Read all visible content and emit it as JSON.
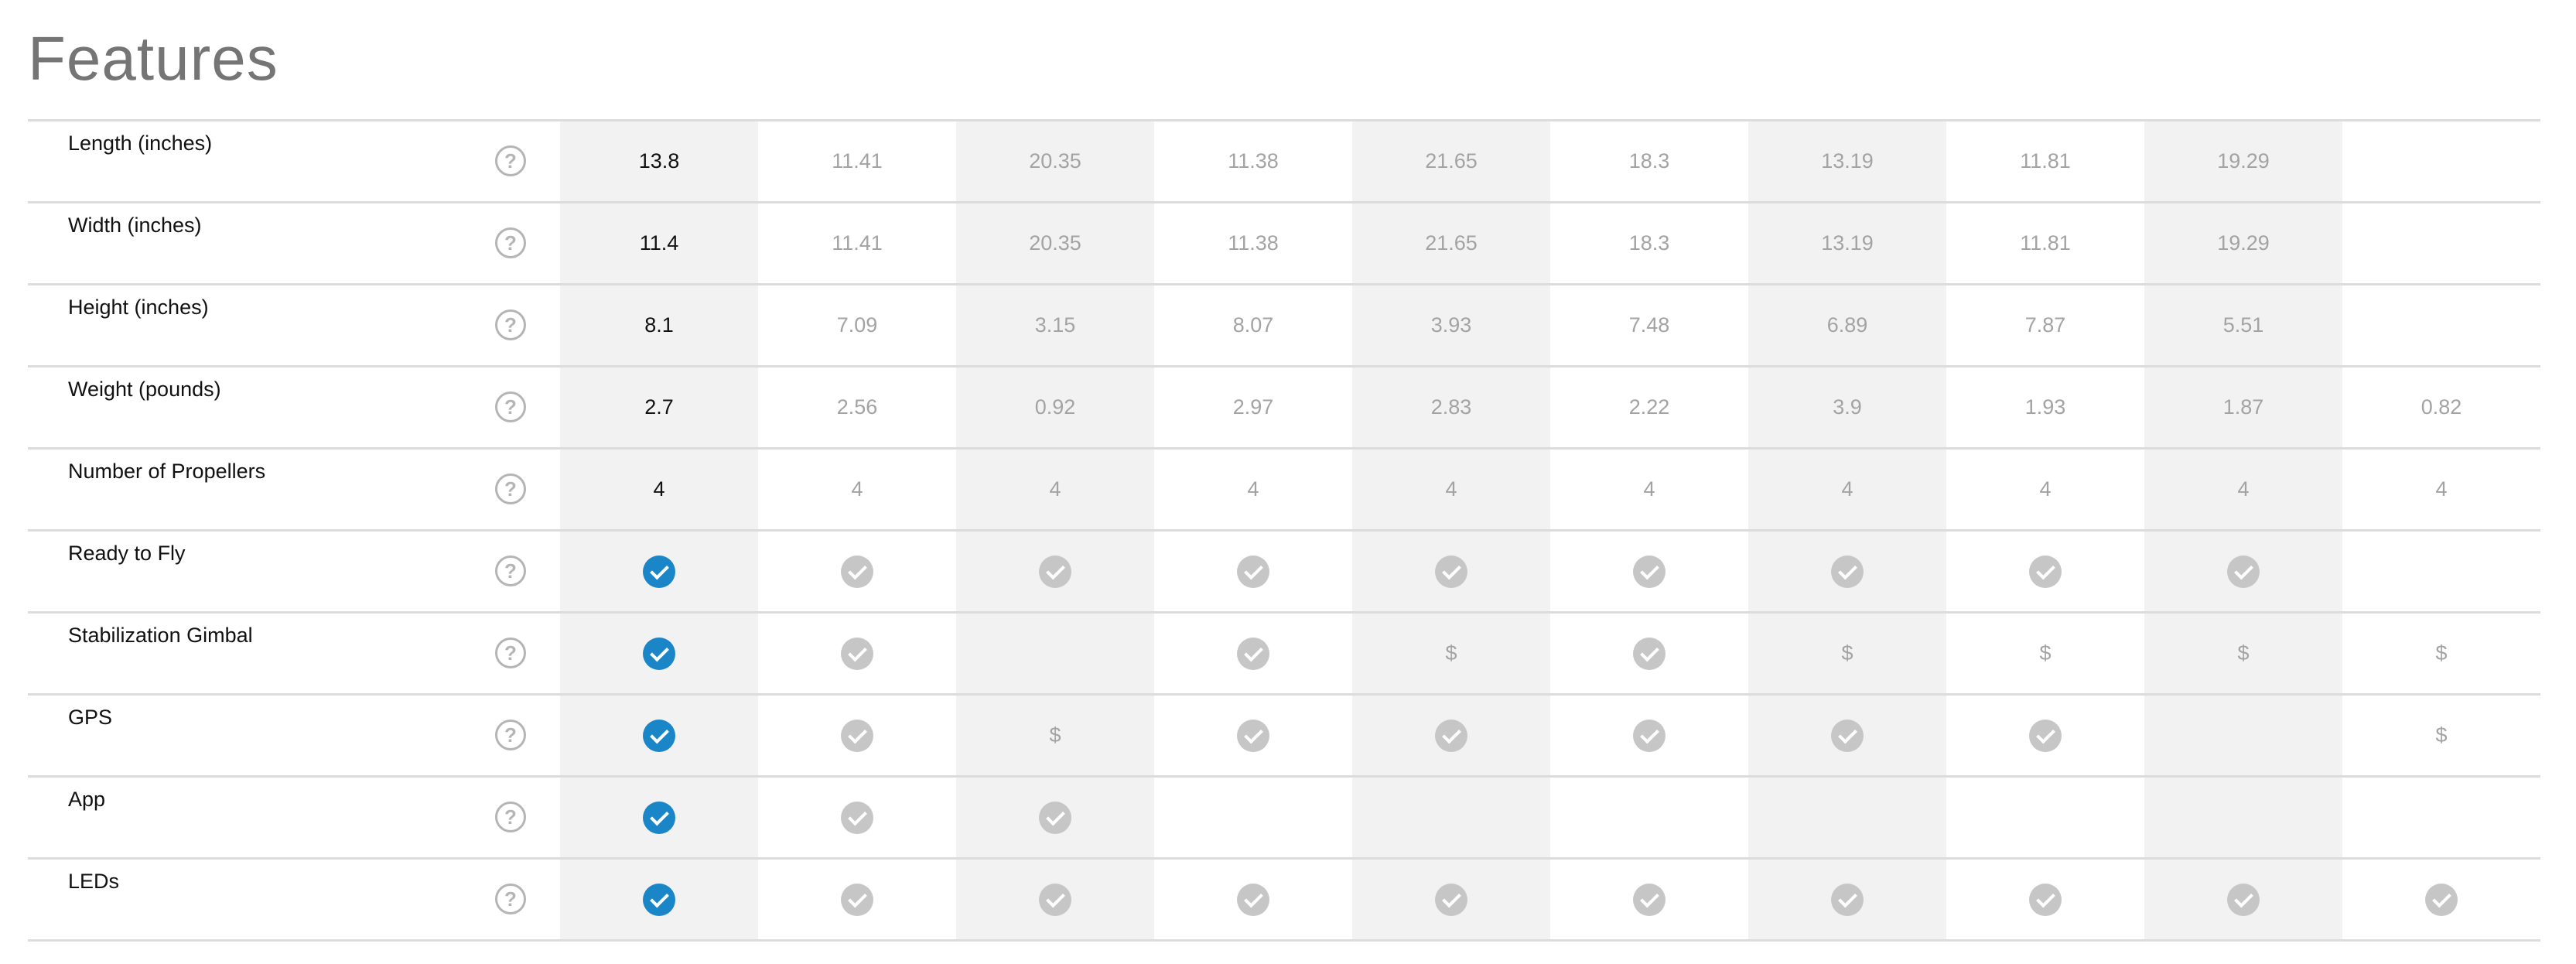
{
  "page": {
    "title": "Features"
  },
  "table": {
    "help_glyph": "?",
    "cell_types": {
      "check": "check-circle-icon",
      "dollar": "dollar-icon",
      "empty": "empty"
    },
    "colors": {
      "active_check": "#1a86c7",
      "inactive_check": "#c6c6c6",
      "column_shade": "#f2f2f2",
      "muted_text": "#a3a3a3",
      "primary_text": "#111111",
      "row_divider": "#dcdcdc",
      "title": "#757575"
    },
    "rows": [
      {
        "label": "Length (inches)",
        "cells": [
          "13.8",
          "11.41",
          "20.35",
          "11.38",
          "21.65",
          "18.3",
          "13.19",
          "11.81",
          "19.29",
          ""
        ]
      },
      {
        "label": "Width (inches)",
        "cells": [
          "11.4",
          "11.41",
          "20.35",
          "11.38",
          "21.65",
          "18.3",
          "13.19",
          "11.81",
          "19.29",
          ""
        ]
      },
      {
        "label": "Height (inches)",
        "cells": [
          "8.1",
          "7.09",
          "3.15",
          "8.07",
          "3.93",
          "7.48",
          "6.89",
          "7.87",
          "5.51",
          ""
        ]
      },
      {
        "label": "Weight (pounds)",
        "cells": [
          "2.7",
          "2.56",
          "0.92",
          "2.97",
          "2.83",
          "2.22",
          "3.9",
          "1.93",
          "1.87",
          "0.82"
        ]
      },
      {
        "label": "Number of Propellers",
        "cells": [
          "4",
          "4",
          "4",
          "4",
          "4",
          "4",
          "4",
          "4",
          "4",
          "4"
        ]
      },
      {
        "label": "Ready to Fly",
        "cells": [
          "check",
          "check",
          "check",
          "check",
          "check",
          "check",
          "check",
          "check",
          "check",
          ""
        ]
      },
      {
        "label": "Stabilization Gimbal",
        "cells": [
          "check",
          "check",
          "",
          "check",
          "$",
          "check",
          "$",
          "$",
          "$",
          "$"
        ]
      },
      {
        "label": "GPS",
        "cells": [
          "check",
          "check",
          "$",
          "check",
          "check",
          "check",
          "check",
          "check",
          "",
          "$"
        ]
      },
      {
        "label": "App",
        "cells": [
          "check",
          "check",
          "check",
          "",
          "",
          "",
          "",
          "",
          "",
          ""
        ]
      },
      {
        "label": "LEDs",
        "cells": [
          "check",
          "check",
          "check",
          "check",
          "check",
          "check",
          "check",
          "check",
          "check",
          "check"
        ]
      }
    ]
  }
}
